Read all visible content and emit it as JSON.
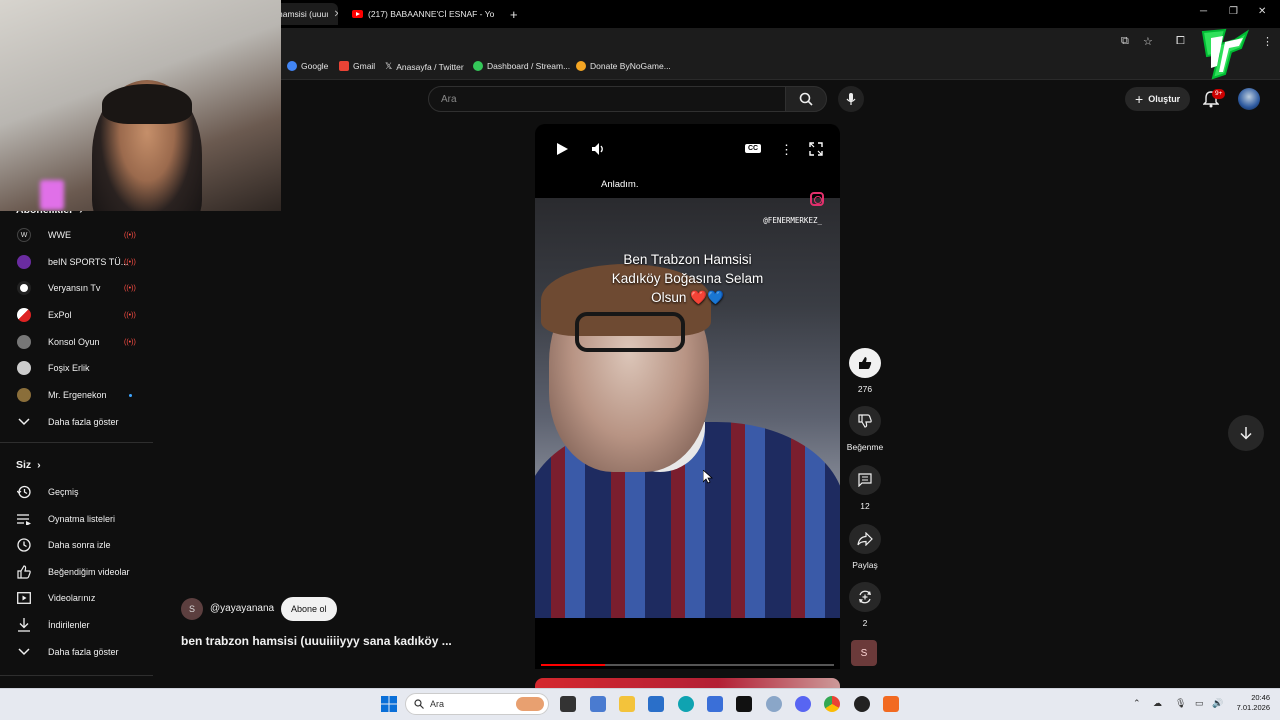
{
  "browser": {
    "tabs": [
      {
        "label": "hamsisi (uuuı",
        "active": true
      },
      {
        "label": "(217) BABAANNE'Cİ ESNAF - Yo",
        "active": false
      }
    ],
    "new_tab_glyph": "+",
    "bookmarks": [
      {
        "label": "Google",
        "color": "#4285f4"
      },
      {
        "label": "Gmail",
        "color": "#ea4335"
      },
      {
        "label": "Anasayfa / Twitter",
        "color": "#ffffff"
      },
      {
        "label": "Dashboard / Stream...",
        "color": "#34c759"
      },
      {
        "label": "Donate ByNoGame...",
        "color": "#f5a623"
      }
    ]
  },
  "masthead": {
    "search_placeholder": "Ara",
    "create_label": "Oluştur",
    "notif_badge": "9+"
  },
  "sidebar": {
    "subscriptions_header": "Abonelikler",
    "channels": [
      {
        "label": "WWE",
        "status": "live",
        "color": "#222"
      },
      {
        "label": "beIN SPORTS TÜ...",
        "status": "live",
        "color": "#6a2ca0"
      },
      {
        "label": "Veryansın Tv",
        "status": "live",
        "color": "#ffffff"
      },
      {
        "label": "ExPol",
        "status": "live",
        "color": "#d22"
      },
      {
        "label": "Konsol Oyun",
        "status": "live",
        "color": "#777"
      },
      {
        "label": "Foşix Erlik",
        "status": "",
        "color": "#ccc"
      },
      {
        "label": "Mr. Ergenekon",
        "status": "new",
        "color": "#8a6e3a"
      }
    ],
    "show_more_subs": "Daha fazla göster",
    "you_header": "Siz",
    "you_items": [
      {
        "label": "Geçmiş",
        "icon": "history-icon"
      },
      {
        "label": "Oynatma listeleri",
        "icon": "playlists-icon"
      },
      {
        "label": "Daha sonra izle",
        "icon": "watch-later-icon"
      },
      {
        "label": "Beğendiğim videolar",
        "icon": "liked-videos-icon"
      },
      {
        "label": "Videolarınız",
        "icon": "your-videos-icon"
      },
      {
        "label": "İndirilenler",
        "icon": "downloads-icon"
      }
    ],
    "show_more_you": "Daha fazla göster"
  },
  "player": {
    "caption": "Anladım.",
    "handle": "@FENERMERKEZ_",
    "overlay_text": "Ben Trabzon Hamsisi\nKadıköy Boğasına Selam\nOlsun ❤️💙",
    "cc_label": "CC",
    "progress": 0.22
  },
  "actions": {
    "like_count": "276",
    "dislike_label": "Beğenme",
    "comment_count": "12",
    "share_label": "Paylaş",
    "remix_count": "2",
    "channel_initial": "S"
  },
  "short": {
    "channel_initial": "S",
    "channel_handle": "@yayayanana",
    "subscribe_label": "Abone ol",
    "title": "ben trabzon hamsisi (uuuiiiiyyy sana kadıköy ..."
  },
  "taskbar": {
    "search_placeholder": "Ara",
    "time": "20:46",
    "date": "7.01.2026"
  }
}
